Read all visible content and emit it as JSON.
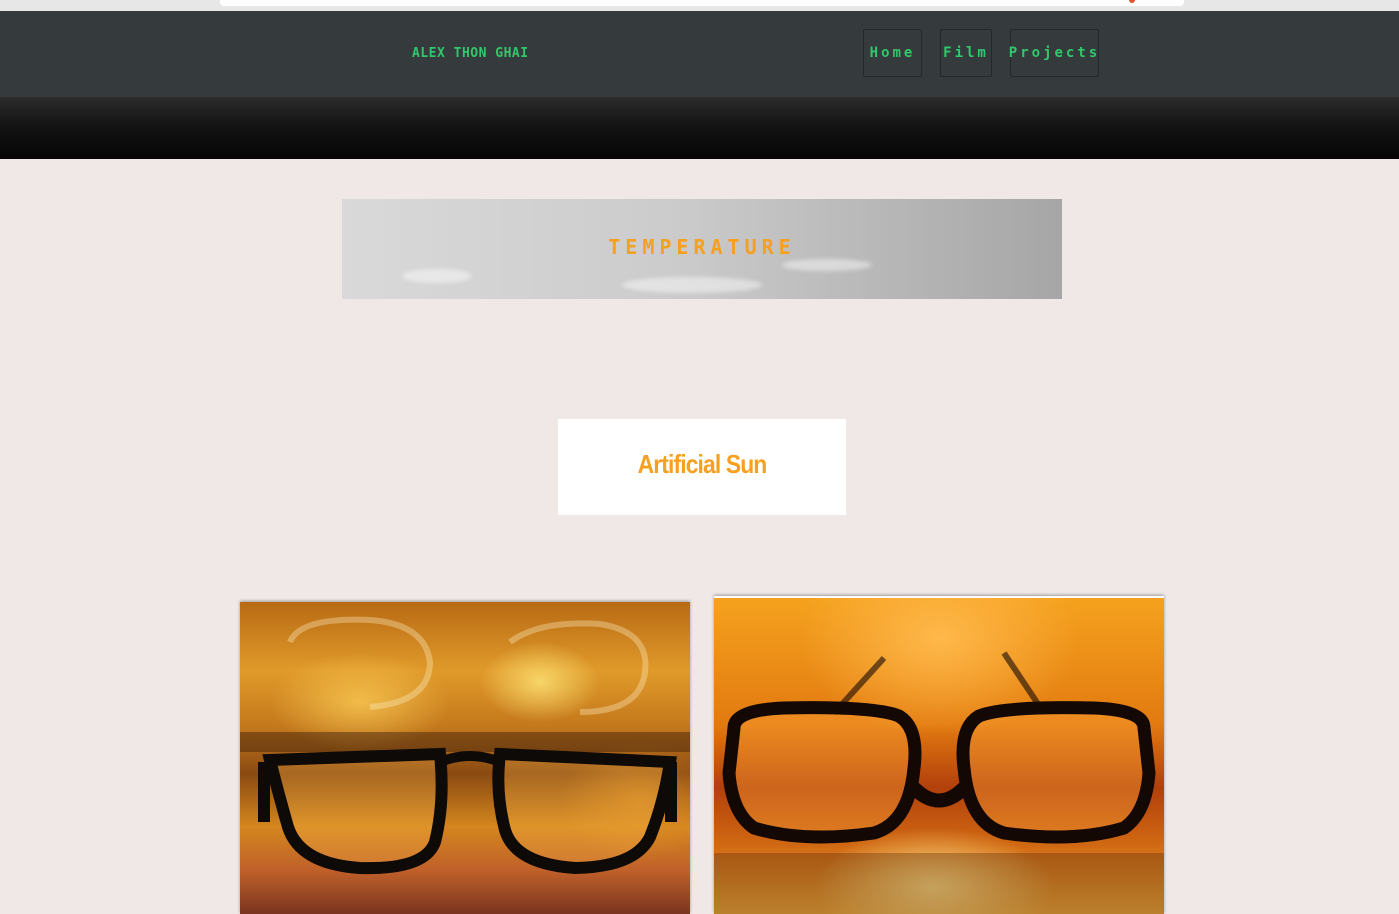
{
  "nav": {
    "brand": "ALEX THON GHAI",
    "items": [
      {
        "label": "Home"
      },
      {
        "label": "Film"
      },
      {
        "label": "Projects"
      }
    ]
  },
  "banner": {
    "title": "TEMPERATURE"
  },
  "section": {
    "title": "Artificial Sun"
  },
  "gallery": {
    "photos": [
      {
        "subject": "glasses half-submerged in water, orange light"
      },
      {
        "subject": "glasses on wet surface, sunset light"
      }
    ]
  },
  "colors": {
    "nav_bg": "#353b3d",
    "nav_text": "#2fc86a",
    "accent": "#f5a020",
    "page_bg": "#efe8e7"
  }
}
